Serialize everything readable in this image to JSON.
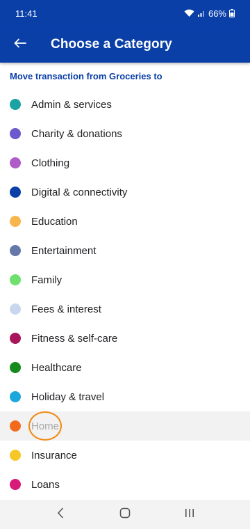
{
  "status_bar": {
    "time": "11:41",
    "battery": "66%",
    "icons": [
      "wifi-icon",
      "signal-icon",
      "battery-icon"
    ]
  },
  "app_bar": {
    "back_icon": "arrow-left-icon",
    "title": "Choose a Category",
    "background": "#0a3fa8"
  },
  "subtitle": "Move transaction from Groceries to",
  "categories": [
    {
      "label": "Admin & services",
      "color": "#1ba3a3"
    },
    {
      "label": "Charity & donations",
      "color": "#6a5acd"
    },
    {
      "label": "Clothing",
      "color": "#b05cc8"
    },
    {
      "label": "Digital & connectivity",
      "color": "#0a3fa8"
    },
    {
      "label": "Education",
      "color": "#f7b64d"
    },
    {
      "label": "Entertainment",
      "color": "#6678a8"
    },
    {
      "label": "Family",
      "color": "#6ee06e"
    },
    {
      "label": "Fees & interest",
      "color": "#c9d7ee"
    },
    {
      "label": "Fitness & self-care",
      "color": "#a8155a"
    },
    {
      "label": "Healthcare",
      "color": "#178a1f"
    },
    {
      "label": "Holiday & travel",
      "color": "#1ba7dc"
    },
    {
      "label": "Home",
      "color": "#f26b1d",
      "pressed": true
    },
    {
      "label": "Insurance",
      "color": "#f7c728"
    },
    {
      "label": "Loans",
      "color": "#d81b78"
    }
  ],
  "nav_bar": {
    "icons": [
      "back-nav-icon",
      "home-nav-icon",
      "recents-nav-icon"
    ]
  }
}
